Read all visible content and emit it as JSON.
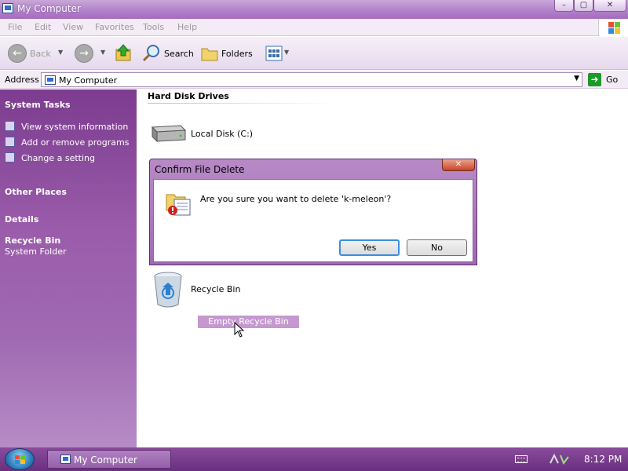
{
  "window": {
    "title": "My Computer",
    "minimize_glyph": "–",
    "maximize_glyph": "▢",
    "close_glyph": "✕"
  },
  "menu": {
    "items": [
      "File",
      "Edit",
      "View",
      "Favorites",
      "Tools",
      "Help"
    ]
  },
  "toolbar": {
    "back_label": "Back",
    "search_label": "Search",
    "folders_label": "Folders"
  },
  "address": {
    "label": "Address",
    "value": "My Computer",
    "go_label": "Go"
  },
  "sidebar": {
    "system_tasks_title": "System Tasks",
    "tasks": [
      "View system information",
      "Add or remove programs",
      "Change a setting"
    ],
    "other_places_title": "Other Places",
    "details_title": "Details",
    "details_name": "Recycle Bin",
    "details_type": "System Folder"
  },
  "content": {
    "group_title": "Hard Disk Drives",
    "drive_label": "Local Disk (C:)",
    "recycle_label": "Recycle Bin",
    "empty_button": "Empty Recycle Bin"
  },
  "dialog": {
    "title": "Confirm File Delete",
    "message": "Are you sure you want to delete 'k-meleon'?",
    "yes_label": "Yes",
    "no_label": "No",
    "close_glyph": "✕"
  },
  "taskbar": {
    "task_label": "My Computer",
    "clock": "8:12 PM"
  },
  "colors": {
    "sidebar": "#8c4aa0",
    "titlebar": "#b07fc8",
    "taskbar": "#7a3c8e",
    "empty_button": "#c598cf"
  }
}
